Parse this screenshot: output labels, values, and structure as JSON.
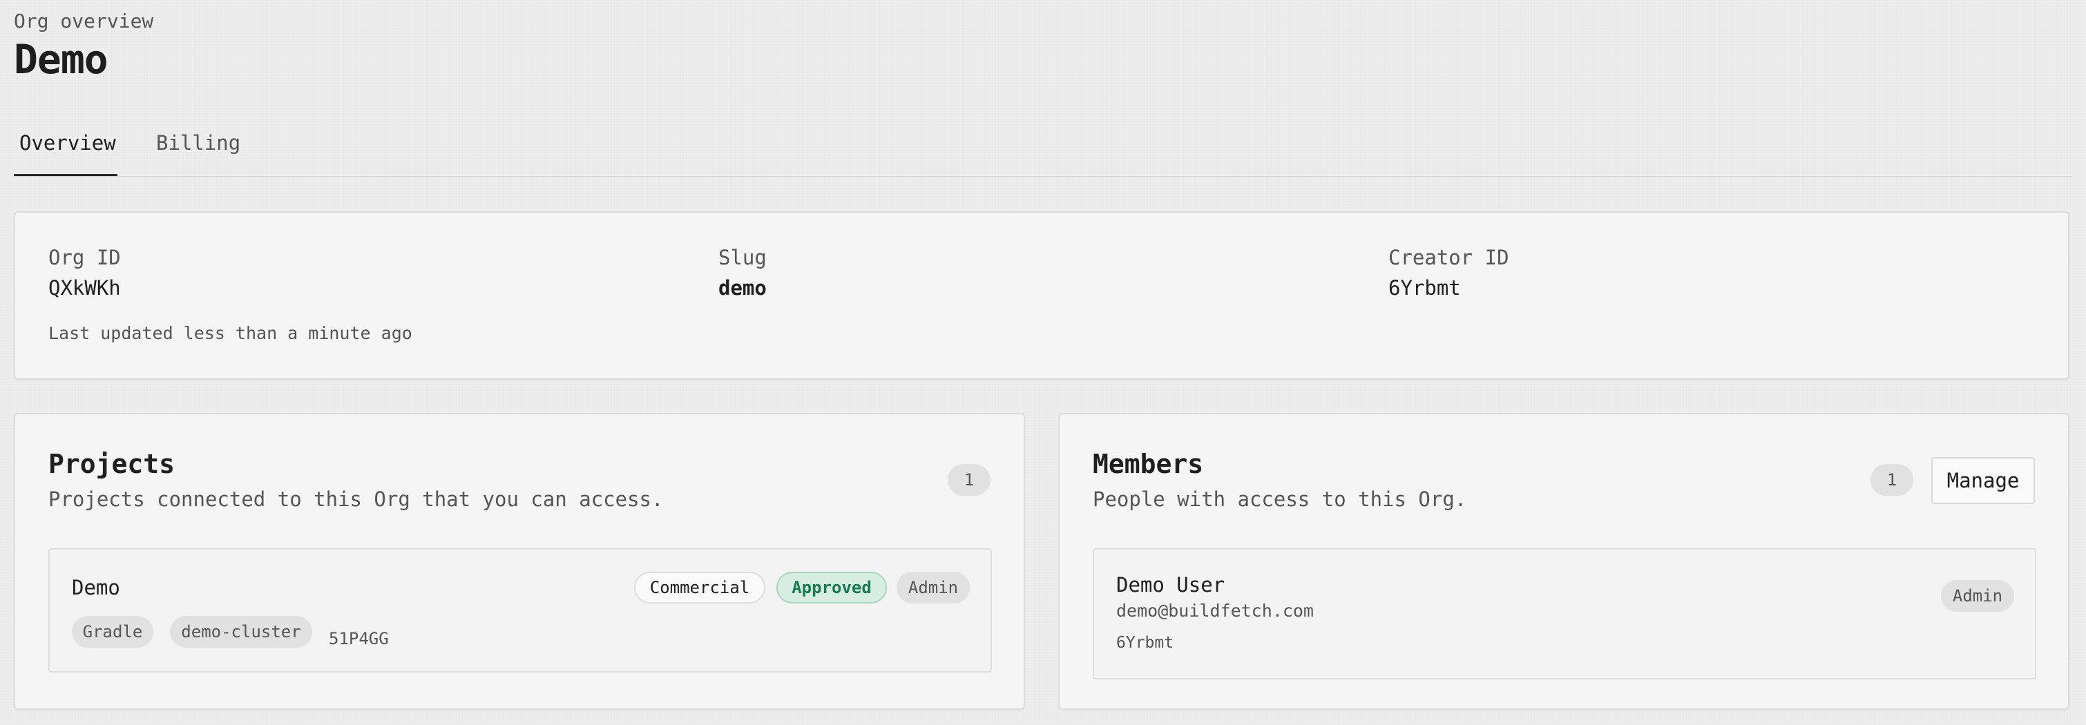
{
  "header": {
    "eyebrow": "Org overview",
    "title": "Demo"
  },
  "tabs": [
    {
      "label": "Overview",
      "active": true
    },
    {
      "label": "Billing",
      "active": false
    }
  ],
  "overview": {
    "fields": [
      {
        "label": "Org ID",
        "value": "QXkWKh"
      },
      {
        "label": "Slug",
        "value": "demo"
      },
      {
        "label": "Creator ID",
        "value": "6Yrbmt"
      }
    ],
    "updated": "Last updated less than a minute ago"
  },
  "projects": {
    "title": "Projects",
    "subtitle": "Projects connected to this Org that you can access.",
    "count": "1",
    "items": [
      {
        "name": "Demo",
        "badges": [
          "Commercial",
          "Approved",
          "Admin"
        ],
        "tags": [
          "Gradle",
          "demo-cluster"
        ],
        "id": "51P4GG"
      }
    ]
  },
  "members": {
    "title": "Members",
    "subtitle": "People with access to this Org.",
    "count": "1",
    "manage_label": "Manage",
    "items": [
      {
        "name": "Demo User",
        "email": "demo@buildfetch.com",
        "id": "6Yrbmt",
        "role": "Admin"
      }
    ]
  },
  "colors": {
    "background": "#efefef",
    "card": "#f5f5f5",
    "approved_bg": "#d6ede2",
    "approved_text": "#1a7a4c",
    "text_primary": "#1e1e1e",
    "text_muted": "#555555"
  }
}
